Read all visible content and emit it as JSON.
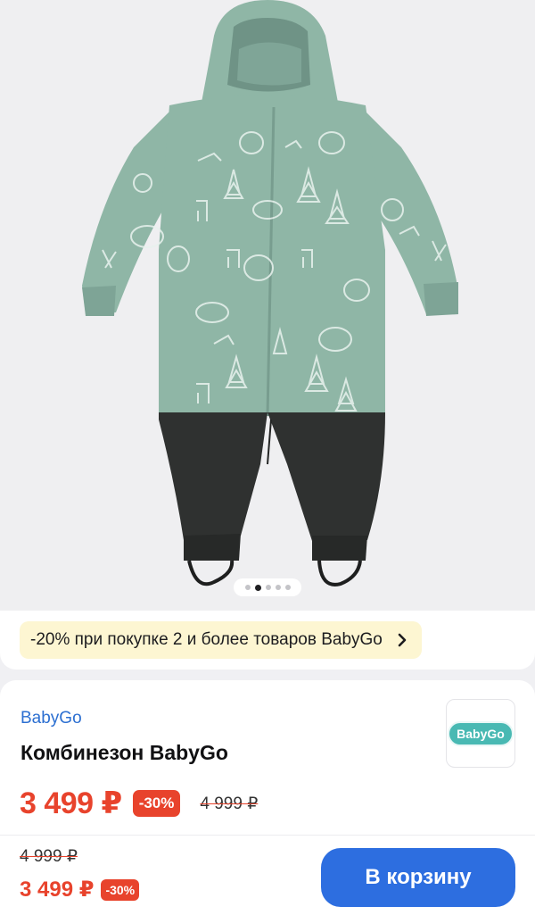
{
  "gallery": {
    "image_alt": "product-photo-kids-snowsuit",
    "slide_count": 5,
    "active_slide": 2,
    "colors": {
      "upper": "#8fb6a6",
      "print": "#e9f2ee",
      "lower": "#2f3130"
    }
  },
  "promo": {
    "text": "-20% при покупке 2 и более товаров BabyGo",
    "icon": "chevron-right-icon"
  },
  "product": {
    "brand": "BabyGo",
    "title": "Комбинезон BabyGo",
    "logo_text": "BabyGo",
    "price": "3 499 ₽",
    "discount": "-30%",
    "old_price": "4 999 ₽"
  },
  "buybar": {
    "old_price": "4 999 ₽",
    "price": "3 499 ₽",
    "discount": "-30%",
    "cart_label": "В корзину"
  },
  "colors": {
    "accent": "#2d6ee0",
    "sale": "#e8432c",
    "brand_link": "#2c6fd1",
    "promo_bg": "#fdf6d2"
  }
}
